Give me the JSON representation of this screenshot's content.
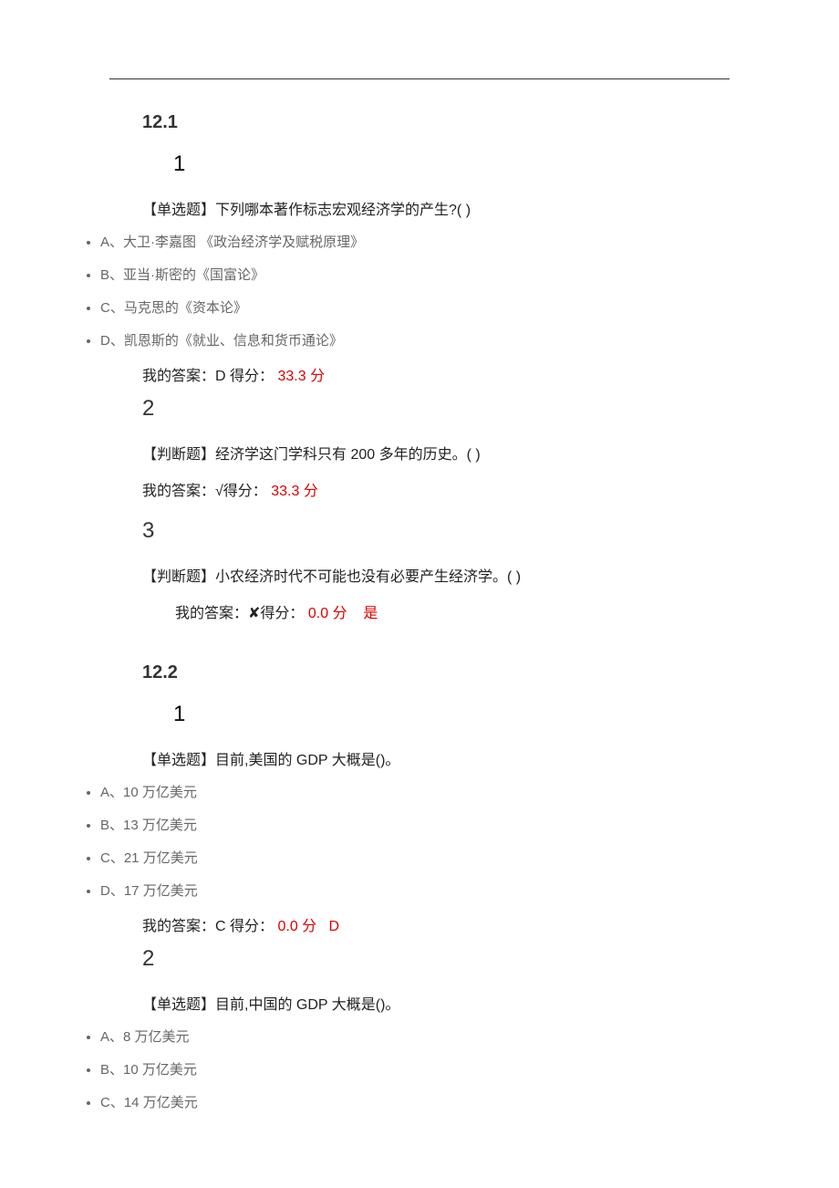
{
  "sections": [
    {
      "id": "12.1",
      "questions": [
        {
          "num": "1",
          "type_prefix": "【单选题】",
          "text": "下列哪本著作标志宏观经济学的产生?( )",
          "options": [
            {
              "letter": "A、",
              "text": "大卫·李嘉图 《政治经济学及赋税原理》"
            },
            {
              "letter": "B、",
              "text": "亚当·斯密的《国富论》"
            },
            {
              "letter": "C、",
              "text": "马克思的《资本论》"
            },
            {
              "letter": "D、",
              "text": "凯恩斯的《就业、信息和货币通论》"
            }
          ],
          "answer_prefix": "我的答案：",
          "answer_value": "D",
          "score_label": " 得分：",
          "score_value": " 33.3 分",
          "correct_note": ""
        },
        {
          "num": "2",
          "type_prefix": "【判断题】",
          "text": "经济学这门学科只有 200 多年的历史。( )",
          "answer_prefix": "我的答案：",
          "answer_value": "√",
          "score_label": "得分：",
          "score_value": " 33.3 分",
          "correct_note": ""
        },
        {
          "num": "3",
          "type_prefix": "【判断题】",
          "text": "小农经济时代不可能也没有必要产生经济学。( )",
          "answer_prefix": "我的答案：",
          "answer_value": "✘",
          "score_label": "得分：",
          "score_value": " 0.0 分",
          "correct_note": "是",
          "answer_indent": true
        }
      ]
    },
    {
      "id": "12.2",
      "questions": [
        {
          "num": "1",
          "type_prefix": "【单选题】",
          "text": "目前,美国的 GDP 大概是()。",
          "options": [
            {
              "letter": "A、",
              "text": "10 万亿美元"
            },
            {
              "letter": "B、",
              "text": "13 万亿美元"
            },
            {
              "letter": "C、",
              "text": "21 万亿美元"
            },
            {
              "letter": "D、",
              "text": "17 万亿美元"
            }
          ],
          "answer_prefix": "我的答案：",
          "answer_value": "C",
          "score_label": " 得分：",
          "score_value": " 0.0 分",
          "correct_note": "D"
        },
        {
          "num": "2",
          "type_prefix": "【单选题】",
          "text": "目前,中国的 GDP 大概是()。",
          "options": [
            {
              "letter": "A、",
              "text": "8 万亿美元"
            },
            {
              "letter": "B、",
              "text": "10 万亿美元"
            },
            {
              "letter": "C、",
              "text": "14 万亿美元"
            }
          ]
        }
      ]
    }
  ]
}
